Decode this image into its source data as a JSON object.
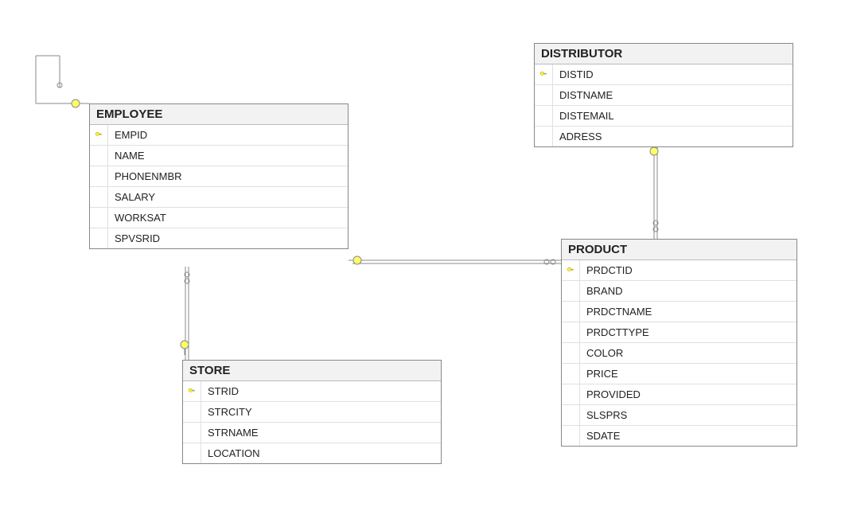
{
  "tables": {
    "employee": {
      "title": "EMPLOYEE",
      "columns": [
        {
          "name": "EMPID",
          "pk": true
        },
        {
          "name": "NAME",
          "pk": false
        },
        {
          "name": "PHONENMBR",
          "pk": false
        },
        {
          "name": "SALARY",
          "pk": false
        },
        {
          "name": "WORKSAT",
          "pk": false
        },
        {
          "name": "SPVSRID",
          "pk": false
        }
      ]
    },
    "distributor": {
      "title": "DISTRIBUTOR",
      "columns": [
        {
          "name": "DISTID",
          "pk": true
        },
        {
          "name": "DISTNAME",
          "pk": false
        },
        {
          "name": "DISTEMAIL",
          "pk": false
        },
        {
          "name": "ADRESS",
          "pk": false
        }
      ]
    },
    "store": {
      "title": "STORE",
      "columns": [
        {
          "name": "STRID",
          "pk": true
        },
        {
          "name": "STRCITY",
          "pk": false
        },
        {
          "name": "STRNAME",
          "pk": false
        },
        {
          "name": "LOCATION",
          "pk": false
        }
      ]
    },
    "product": {
      "title": "PRODUCT",
      "columns": [
        {
          "name": "PRDCTID",
          "pk": true
        },
        {
          "name": "BRAND",
          "pk": false
        },
        {
          "name": "PRDCTNAME",
          "pk": false
        },
        {
          "name": "PRDCTTYPE",
          "pk": false
        },
        {
          "name": "COLOR",
          "pk": false
        },
        {
          "name": "PRICE",
          "pk": false
        },
        {
          "name": "PROVIDED",
          "pk": false
        },
        {
          "name": "SLSPRS",
          "pk": false
        },
        {
          "name": "SDATE",
          "pk": false
        }
      ]
    }
  },
  "relationships": [
    {
      "from": "EMPLOYEE.SPVSRID",
      "to": "EMPLOYEE.EMPID",
      "type": "self"
    },
    {
      "from": "EMPLOYEE.WORKSAT",
      "to": "STORE.STRID",
      "type": "one-to-many"
    },
    {
      "from": "PRODUCT.SLSPRS",
      "to": "EMPLOYEE.EMPID",
      "type": "one-to-many"
    },
    {
      "from": "PRODUCT.PROVIDED",
      "to": "DISTRIBUTOR.DISTID",
      "type": "one-to-many"
    }
  ]
}
